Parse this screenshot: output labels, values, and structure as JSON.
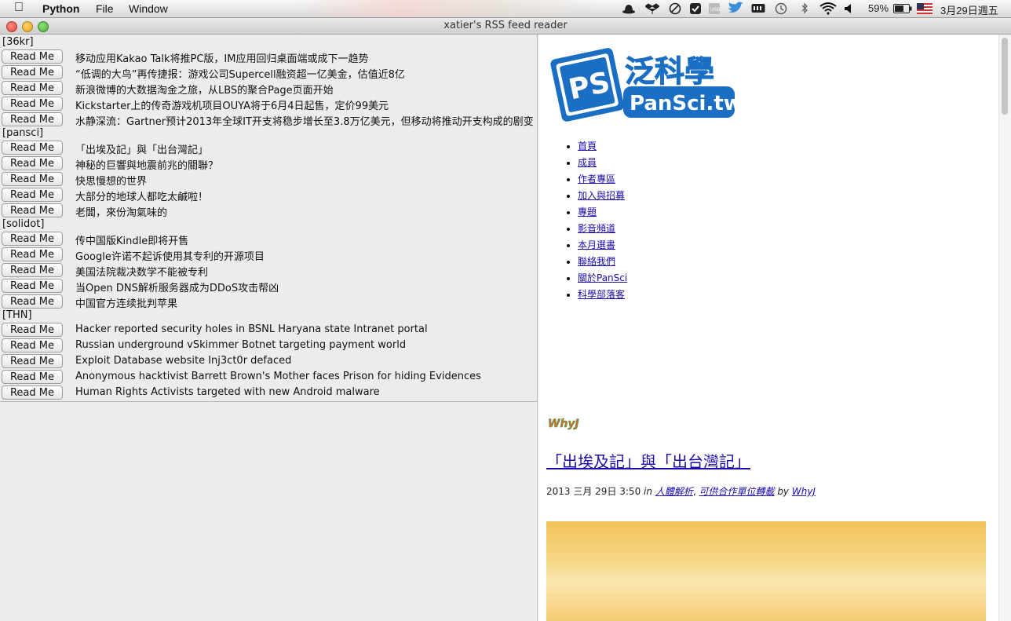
{
  "menubar": {
    "app": "Python",
    "menus": [
      "File",
      "Window"
    ],
    "battery": "59%",
    "clock": "3月29日週五"
  },
  "window": {
    "title": "xatier's RSS feed reader"
  },
  "read_button_label": "Read Me",
  "feeds": [
    {
      "label": "[36kr]",
      "articles": [
        "移动应用Kakao Talk将推PC版，IM应用回归桌面端或成下一趋势",
        "“低调的大鸟”再传捷报：游戏公司Supercell融资超一亿美金，估值近8亿",
        "新浪微博的大数据淘金之旅，从LBS的聚合Page页面开始",
        "Kickstarter上的传奇游戏机项目OUYA将于6月4日起售，定价99美元",
        "水静深流：Gartner预计2013年全球IT开支将稳步增长至3.8万亿美元，但移动将推动开支构成的剧变"
      ]
    },
    {
      "label": "[pansci]",
      "articles": [
        "「出埃及記」與「出台灣記」",
        "神秘的巨響與地震前兆的關聯？",
        "快思慢想的世界",
        "大部分的地球人都吃太鹹啦！",
        "老闆，來份淘氣味的"
      ]
    },
    {
      "label": "[solidot]",
      "articles": [
        "传中国版Kindle即将开售",
        "Google许诺不起诉使用其专利的开源项目",
        "美国法院裁决数学不能被专利",
        "当Open DNS解析服务器成为DDoS攻击帮凶",
        "中国官方连续批判苹果"
      ]
    },
    {
      "label": "[THN]",
      "articles": [
        "Hacker reported security holes in BSNL Haryana state Intranet portal",
        "Russian underground vSkimmer Botnet targeting payment world",
        "Exploit Database website Inj3ct0r defaced",
        "Anonymous hacktivist Barrett Brown's Mother faces Prison for hiding Evidences",
        "Human Rights Activists targeted with new Android malware"
      ]
    }
  ],
  "web": {
    "logo_text": "泛科學",
    "logo_sub": "PanSci.tw",
    "logo_badge": "PS",
    "nav": [
      "首頁",
      "成員",
      "作者專區",
      "加入與招募",
      "專題",
      "影音頻道",
      "本月選書",
      "聯絡我們",
      "關於PanSci",
      "科學部落客"
    ],
    "whyj": "WhyJ",
    "post_title": "「出埃及記」與「出台灣記」",
    "post_date": "2013 三月 29日 3:50",
    "post_in": "in",
    "post_cat1": "人體解析",
    "post_sep": ", ",
    "post_cat2": "可供合作單位轉載",
    "post_by": "by",
    "post_author": "WhyJ"
  },
  "colors": {
    "logo_blue": "#1a6fc4",
    "link": "#1a0dab"
  }
}
